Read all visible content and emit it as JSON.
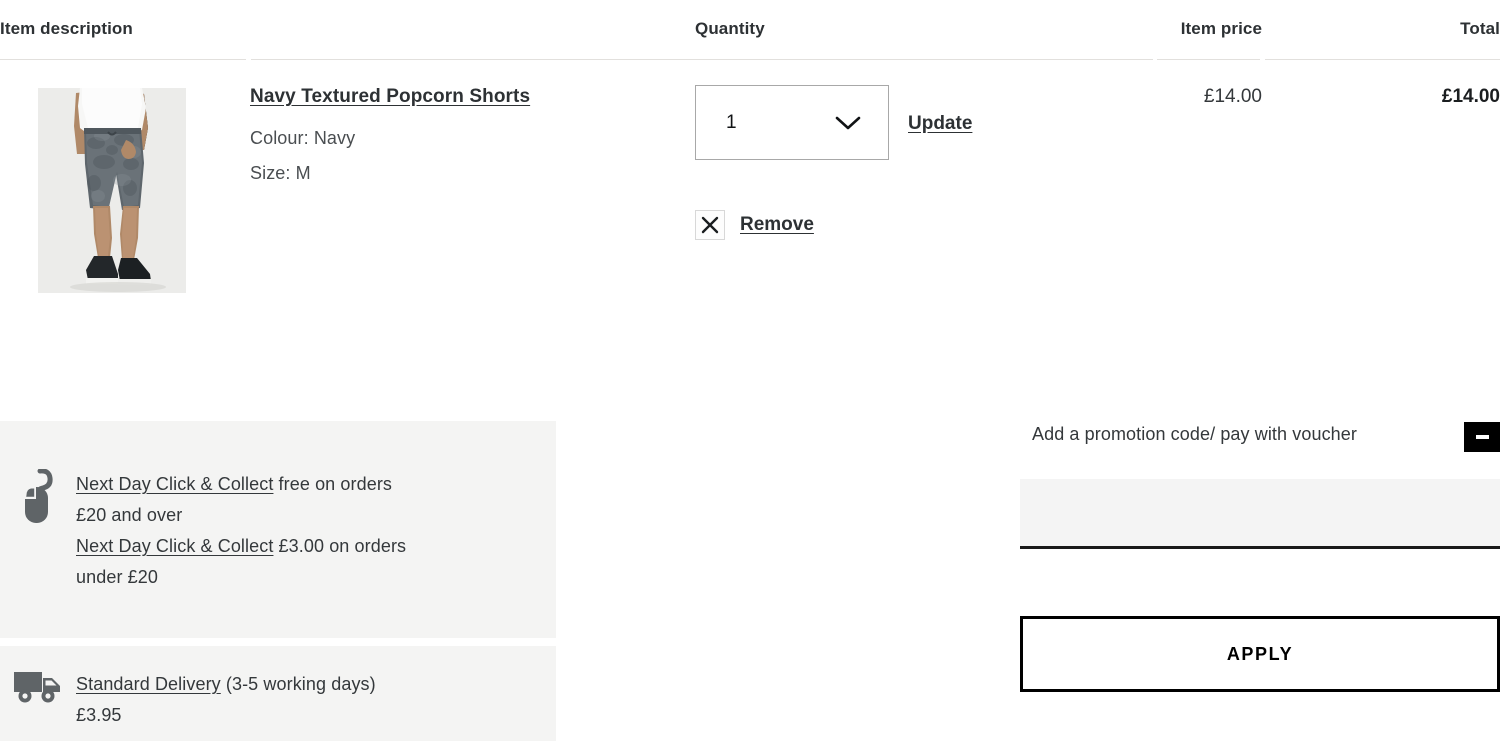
{
  "table": {
    "headers": {
      "item_description": "Item description",
      "quantity": "Quantity",
      "item_price": "Item price",
      "total": "Total"
    }
  },
  "item": {
    "name": "Navy Textured Popcorn Shorts",
    "colour": "Colour: Navy",
    "size": "Size: M",
    "quantity_value": "1",
    "update_label": "Update",
    "remove_label": "Remove",
    "remove_icon": "close-x-icon",
    "chevron_icon": "chevron-down-icon",
    "item_price": "£14.00",
    "total": "£14.00",
    "image_alt": "Model wearing navy textured popcorn shorts with white t-shirt and black slip-on trainers"
  },
  "delivery": {
    "click_collect": {
      "icon": "mouse-icon",
      "line1_link": "Next Day Click & Collect",
      "line1_rest": " free on orders",
      "line2": "£20 and over",
      "line3_link": "Next Day Click & Collect",
      "line3_rest": " £3.00 on orders",
      "line4": "under £20"
    },
    "standard": {
      "icon": "delivery-truck-icon",
      "line1_link": "Standard Delivery",
      "line1_rest": " (3-5 working days)",
      "line2": "£3.95"
    }
  },
  "promotion": {
    "label": "Add a promotion code/ pay with voucher",
    "toggle_icon": "minus-icon",
    "input_value": "",
    "input_placeholder": "",
    "apply_label": "APPLY"
  },
  "colors": {
    "text": "#2d3134",
    "muted_text": "#34383b",
    "panel_bg": "#f4f4f3",
    "input_bg": "#f4f4f4",
    "rule": "#e2e0dd",
    "accent": "#000000",
    "select_border": "#a8a8a8"
  }
}
